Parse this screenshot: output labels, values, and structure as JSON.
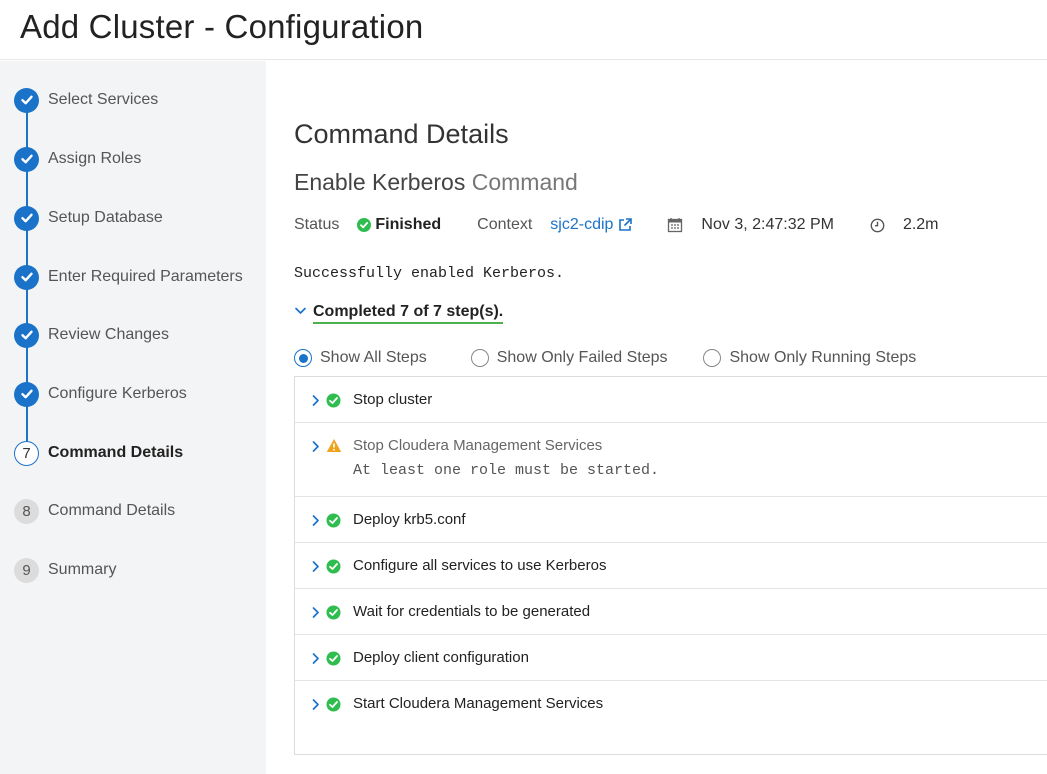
{
  "page": {
    "title": "Add Cluster - Configuration"
  },
  "sidebar": {
    "steps": [
      {
        "num": "",
        "label": "Select Services",
        "state": "done"
      },
      {
        "num": "",
        "label": "Assign Roles",
        "state": "done"
      },
      {
        "num": "",
        "label": "Setup Database",
        "state": "done"
      },
      {
        "num": "",
        "label": "Enter Required Parameters",
        "state": "done"
      },
      {
        "num": "",
        "label": "Review Changes",
        "state": "done"
      },
      {
        "num": "",
        "label": "Configure Kerberos",
        "state": "done"
      },
      {
        "num": "7",
        "label": "Command Details",
        "state": "current"
      },
      {
        "num": "8",
        "label": "Command Details",
        "state": "todo"
      },
      {
        "num": "9",
        "label": "Summary",
        "state": "todo"
      }
    ]
  },
  "main": {
    "section_title": "Command Details",
    "command_name": "Enable Kerberos",
    "command_suffix": "Command",
    "status_label": "Status",
    "status_value": "Finished",
    "context_label": "Context",
    "context_value": "sjc2-cdip",
    "timestamp": "Nov 3, 2:47:32 PM",
    "duration": "2.2m",
    "message": "Successfully enabled Kerberos.",
    "completed_text": "Completed 7 of 7 step(s).",
    "filters": [
      {
        "label": "Show All Steps",
        "selected": true
      },
      {
        "label": "Show Only Failed Steps",
        "selected": false
      },
      {
        "label": "Show Only Running Steps",
        "selected": false
      }
    ],
    "steps": [
      {
        "name": "Stop cluster",
        "status": "success",
        "detail": ""
      },
      {
        "name": "Stop Cloudera Management Services",
        "status": "warning",
        "detail": "At least one role must be started."
      },
      {
        "name": "Deploy krb5.conf",
        "status": "success",
        "detail": ""
      },
      {
        "name": "Configure all services to use Kerberos",
        "status": "success",
        "detail": ""
      },
      {
        "name": "Wait for credentials to be generated",
        "status": "success",
        "detail": ""
      },
      {
        "name": "Deploy client configuration",
        "status": "success",
        "detail": ""
      },
      {
        "name": "Start Cloudera Management Services",
        "status": "success",
        "detail": ""
      }
    ]
  },
  "colors": {
    "accent": "#1a73c9",
    "success": "#2ebd4e",
    "warning": "#f0a21b"
  }
}
